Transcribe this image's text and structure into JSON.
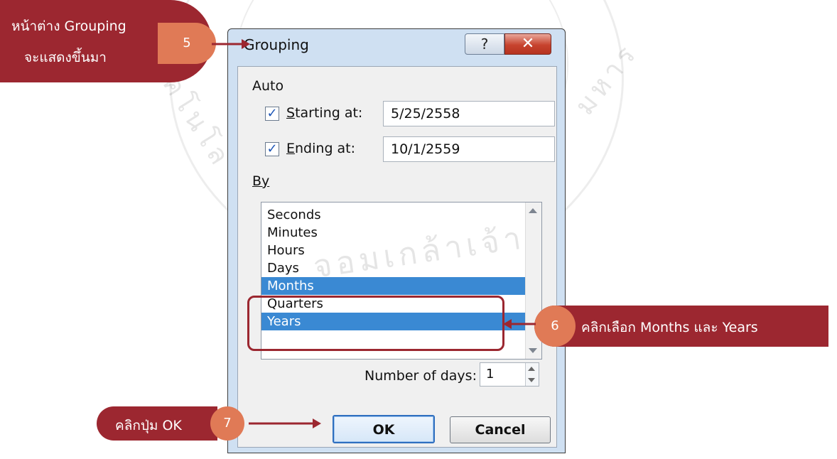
{
  "watermark": {
    "text_bottom": "จอมเกล้าเจ้า",
    "text_left": "คโนโล",
    "text_right": "มหาร"
  },
  "dialog": {
    "title": "Grouping",
    "help_label": "?",
    "close_label": "✕",
    "auto_label": "Auto",
    "starting_at": {
      "label": "Starting at:",
      "value": "5/25/2558",
      "checked": true
    },
    "ending_at": {
      "label": "Ending at:",
      "value": "10/1/2559",
      "checked": true
    },
    "by_label": "By",
    "by_items": [
      {
        "label": "Seconds",
        "selected": false
      },
      {
        "label": "Minutes",
        "selected": false
      },
      {
        "label": "Hours",
        "selected": false
      },
      {
        "label": "Days",
        "selected": false
      },
      {
        "label": "Months",
        "selected": true
      },
      {
        "label": "Quarters",
        "selected": false
      },
      {
        "label": "Years",
        "selected": true
      }
    ],
    "number_of_days_label": "Number of days:",
    "number_of_days_value": "1",
    "ok_label": "OK",
    "cancel_label": "Cancel"
  },
  "annotations": {
    "step5": {
      "number": "5",
      "line1": "หน้าต่าง Grouping",
      "line2": "จะแสดงขึ้นมา"
    },
    "step6": {
      "number": "6",
      "text": "คลิกเลือก Months และ Years"
    },
    "step7": {
      "number": "7",
      "text": "คลิกปุ่ม OK"
    }
  },
  "colors": {
    "callout": "#9c2730",
    "number_circle": "#e07a56",
    "selection": "#3a89d3",
    "dialog_frame": "#cfe0f2"
  }
}
